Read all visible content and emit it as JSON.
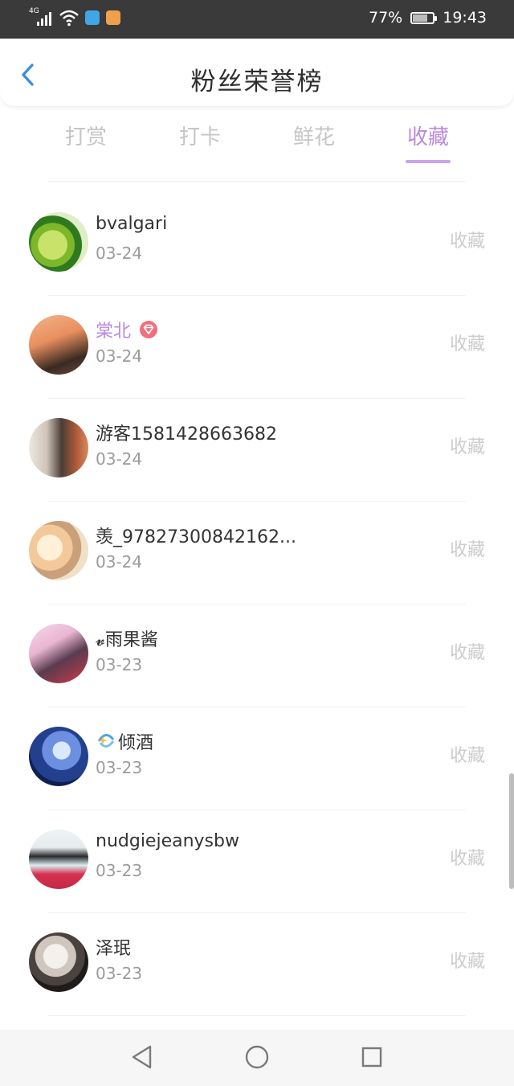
{
  "status_bar": {
    "network": "4G",
    "battery_percent": "77%",
    "battery_level": 0.77,
    "time": "19:43"
  },
  "header": {
    "title": "粉丝荣誉榜"
  },
  "tabs": [
    {
      "label": "打赏"
    },
    {
      "label": "打卡"
    },
    {
      "label": "鲜花"
    },
    {
      "label": "收藏",
      "active": true
    }
  ],
  "fans": [
    {
      "name": "bvalgari",
      "date": "03-24",
      "action": "收藏"
    },
    {
      "name": "棠北",
      "date": "03-24",
      "action": "收藏",
      "vip": true
    },
    {
      "name": "游客1581428663682",
      "date": "03-24",
      "action": "收藏"
    },
    {
      "name": "羡_97827300842162...",
      "date": "03-24",
      "action": "收藏"
    },
    {
      "name": "𝓿雨果酱",
      "date": "03-23",
      "action": "收藏"
    },
    {
      "name": "倾酒",
      "date": "03-23",
      "action": "收藏"
    },
    {
      "name": "nudgiejeanysbw",
      "date": "03-23",
      "action": "收藏"
    },
    {
      "name": "泽珉",
      "date": "03-23",
      "action": "收藏"
    }
  ],
  "colors": {
    "accent": "#b98be0",
    "back_arrow": "#3a8ee6",
    "status_bar_bg": "#3a3a3a",
    "muted_text": "#9b9b9b"
  }
}
